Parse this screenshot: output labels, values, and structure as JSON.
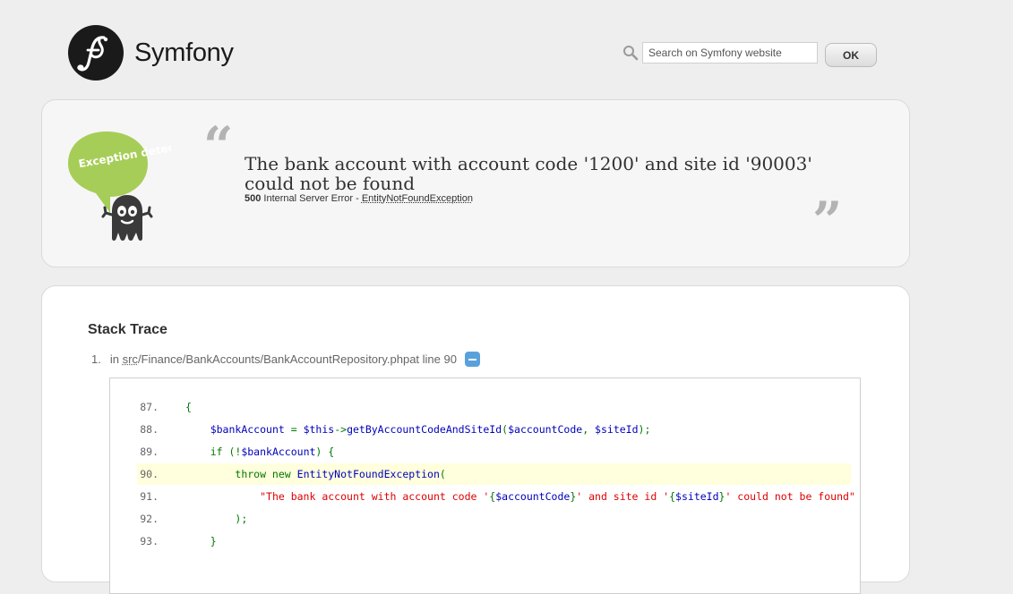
{
  "header": {
    "brand_name": "Symfony",
    "search": {
      "placeholder": "Search on Symfony website",
      "value": ""
    },
    "ok_label": "OK"
  },
  "exception": {
    "mascot_bubble_text": "Exception detected!",
    "message": "The bank account with account code '1200' and site id '90003' could not be found",
    "status_code": "500",
    "status_text": "Internal Server Error - ",
    "exception_class": "EntityNotFoundException"
  },
  "stack_trace": {
    "title": "Stack Trace",
    "items": [
      {
        "number": "1.",
        "prefix": "in ",
        "path_abbr": "src",
        "path_rest": "/Finance/BankAccounts/BankAccountRepository.php",
        "line_text": " at line 90",
        "toggle": "collapse"
      }
    ],
    "code_lines": [
      {
        "number": "87.",
        "selected": false
      },
      {
        "number": "88.",
        "selected": false
      },
      {
        "number": "89.",
        "selected": false
      },
      {
        "number": "90.",
        "selected": true
      },
      {
        "number": "91.",
        "selected": false
      },
      {
        "number": "92.",
        "selected": false
      },
      {
        "number": "93.",
        "selected": false
      }
    ],
    "code": {
      "l87": "{",
      "l88_var": "$bankAccount",
      "l88_eq": " = ",
      "l88_this": "$this",
      "l88_arrow": "->",
      "l88_method": "getByAccountCodeAndSiteId",
      "l88_open": "(",
      "l88_arg1": "$accountCode",
      "l88_comma": ", ",
      "l88_arg2": "$siteId",
      "l88_close": ");",
      "l89_if": "if (!",
      "l89_var": "$bankAccount",
      "l89_close": ") {",
      "l90_throw": "throw new ",
      "l90_class": "EntityNotFoundException",
      "l90_open": "(",
      "l91_s1": "\"The bank account with account code '",
      "l91_b1": "{",
      "l91_v1": "$accountCode",
      "l91_b2": "}",
      "l91_s2": "' and site id '",
      "l91_b3": "{",
      "l91_v2": "$siteId",
      "l91_b4": "}",
      "l91_s3": "' could not be found\"",
      "l92": ");",
      "l93": "}"
    }
  },
  "colors": {
    "page_bg": "#eeeeee",
    "toggle_bg": "#5aa1db",
    "mascot_bubble": "#a6cd57",
    "highlight_line": "#ffffdd"
  }
}
